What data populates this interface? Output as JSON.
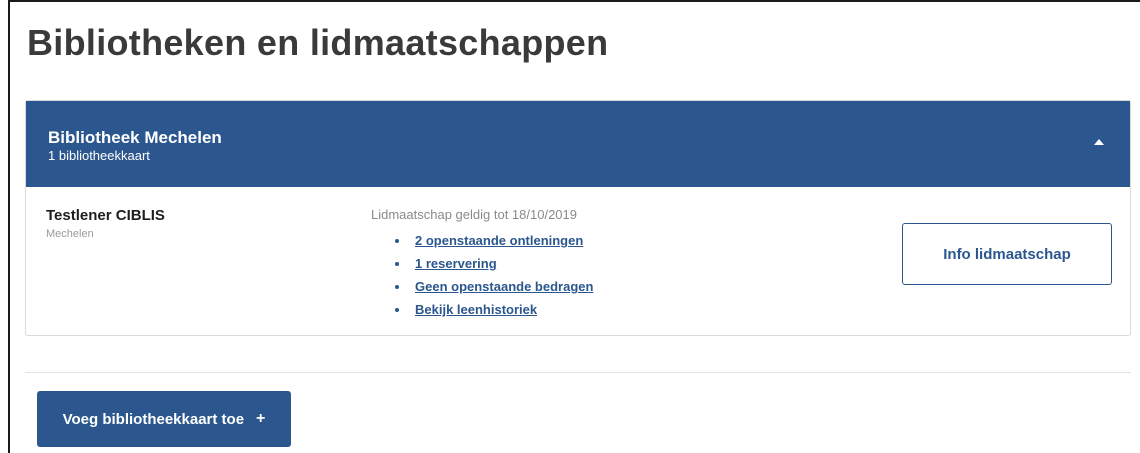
{
  "page": {
    "title": "Bibliotheken en lidmaatschappen"
  },
  "library": {
    "name": "Bibliotheek Mechelen",
    "card_count": "1 bibliotheekkaart",
    "expanded": true,
    "toggle_icon": "chevron-up-icon",
    "member": {
      "name": "Testlener CIBLIS",
      "city": "Mechelen",
      "membership_valid": "Lidmaatschap geldig tot 18/10/2019",
      "links": [
        "2 openstaande ontleningen",
        "1 reservering",
        "Geen openstaande bedragen",
        "Bekijk leenhistoriek"
      ]
    },
    "info_button_label": "Info lidmaatschap"
  },
  "actions": {
    "add_card_label": "Voeg bibliotheekkaart toe",
    "add_icon": "+"
  },
  "colors": {
    "brand_blue": "#2b578e",
    "title_text": "#3a3a3a",
    "muted_text": "#8a8a8a"
  }
}
